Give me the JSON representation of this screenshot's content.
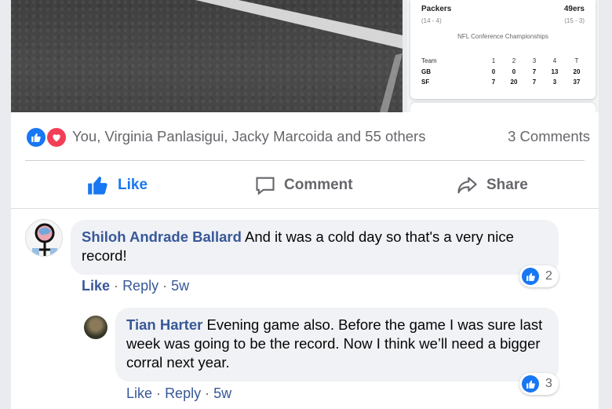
{
  "scorecard": {
    "home_team": "Packers",
    "home_record": "(14 - 4)",
    "away_team": "49ers",
    "away_record": "(15 - 3)",
    "title": "NFL Conference Championships",
    "header": [
      "Team",
      "1",
      "2",
      "3",
      "4",
      "T"
    ],
    "rows": [
      [
        "GB",
        "0",
        "0",
        "7",
        "13",
        "20"
      ],
      [
        "SF",
        "7",
        "20",
        "7",
        "3",
        "37"
      ]
    ]
  },
  "reactions": {
    "names": "You, Virginia Panlasigui, Jacky Marcoida and 55 others",
    "comments_count": "3 Comments",
    "icons": [
      "like-icon",
      "love-icon"
    ],
    "like_color": "#1877f2",
    "love_color": "#f33e58"
  },
  "actions": {
    "like": "Like",
    "comment": "Comment",
    "share": "Share"
  },
  "comments": [
    {
      "author": "Shiloh Andrade Ballard",
      "text": "And it was a cold day so that's a very nice record!",
      "like": "Like",
      "reply": "Reply",
      "time": "5w",
      "reactions": "2",
      "liked": true
    },
    {
      "author": "Tian Harter",
      "text": "Evening game also. Before the game I was sure last week was going to be the record. Now I think we’ll need a bigger corral next year.",
      "like": "Like",
      "reply": "Reply",
      "time": "5w",
      "reactions": "3",
      "liked": false
    }
  ],
  "separator": "·"
}
